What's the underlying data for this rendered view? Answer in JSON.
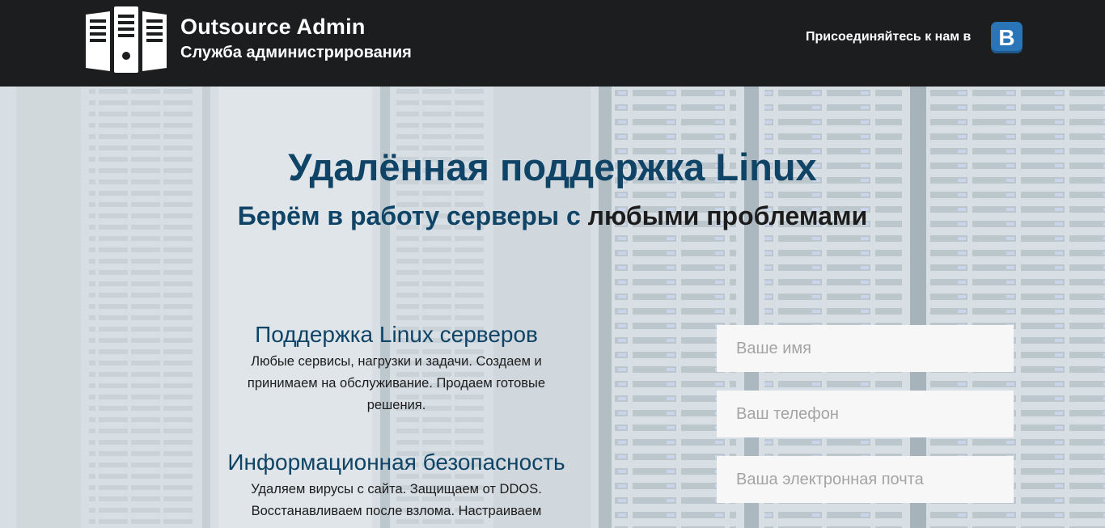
{
  "header": {
    "brand_title": "Outsource Admin",
    "brand_subtitle": "Служба администрирования",
    "join_text": "Присоединяйтесь к нам в",
    "vk_letter": "В",
    "vk_color": "#2a74b8"
  },
  "hero": {
    "title": "Удалённая поддержка Linux",
    "subtitle_part1": "Берём в работу серверы с ",
    "subtitle_part2": "любыми проблемами"
  },
  "features": [
    {
      "title": "Поддержка Linux серверов",
      "text": "Любые сервисы, нагрузки и задачи. Создаем и принимаем на обслуживание. Продаем готовые решения."
    },
    {
      "title": "Информационная безопасность",
      "text": "Удаляем вирусы с сайта. Защищаем от DDOS. Восстанавливаем после взлома. Настраиваем"
    }
  ],
  "form": {
    "name_placeholder": "Ваше имя",
    "phone_placeholder": "Ваш телефон",
    "email_placeholder": "Ваша электронная почта"
  },
  "colors": {
    "header_bg": "#1b1d1e",
    "accent_blue": "#0f4466",
    "field_bg": "#f7f7f7"
  }
}
